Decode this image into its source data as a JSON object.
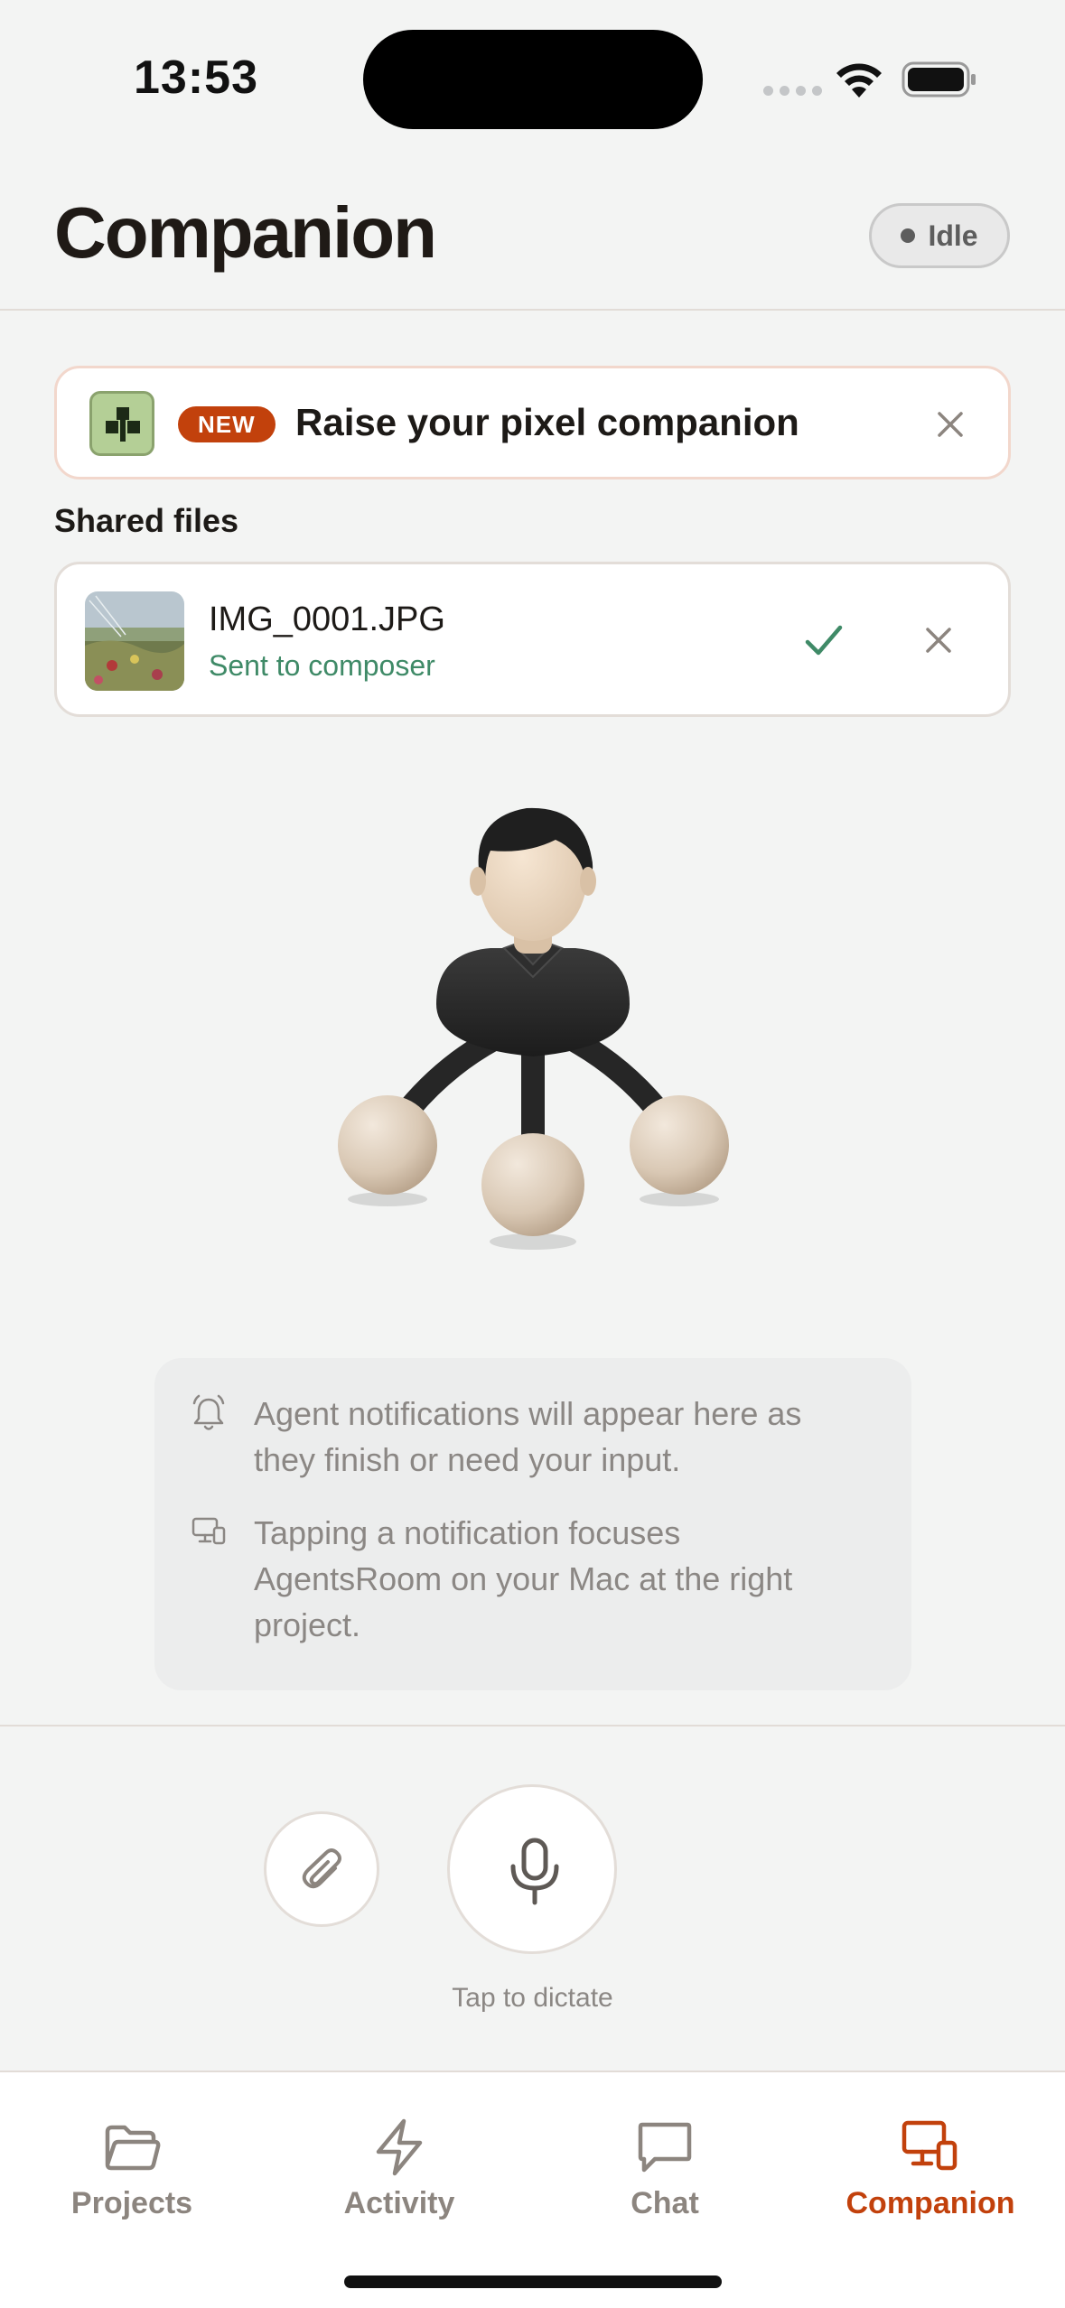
{
  "status_bar": {
    "time": "13:53"
  },
  "header": {
    "title": "Companion",
    "status_label": "Idle"
  },
  "promo": {
    "badge": "NEW",
    "text": "Raise your pixel companion"
  },
  "shared_files": {
    "label": "Shared files",
    "file": {
      "name": "IMG_0001.JPG",
      "status": "Sent to composer"
    }
  },
  "info": {
    "notifications_text": "Agent notifications will appear here as they finish or need your input.",
    "focus_text": "Tapping a notification focuses AgentsRoom on your Mac at the right project."
  },
  "composer": {
    "hint": "Tap to dictate"
  },
  "tabs": [
    {
      "label": "Projects",
      "icon": "folder-icon",
      "active": false
    },
    {
      "label": "Activity",
      "icon": "bolt-icon",
      "active": false
    },
    {
      "label": "Chat",
      "icon": "chat-bubble-icon",
      "active": false
    },
    {
      "label": "Companion",
      "icon": "desktop-phone-icon",
      "active": true
    }
  ],
  "colors": {
    "accent": "#c2410c",
    "success": "#3f8a67",
    "background": "#f3f4f3",
    "muted_text": "#8b8784"
  }
}
